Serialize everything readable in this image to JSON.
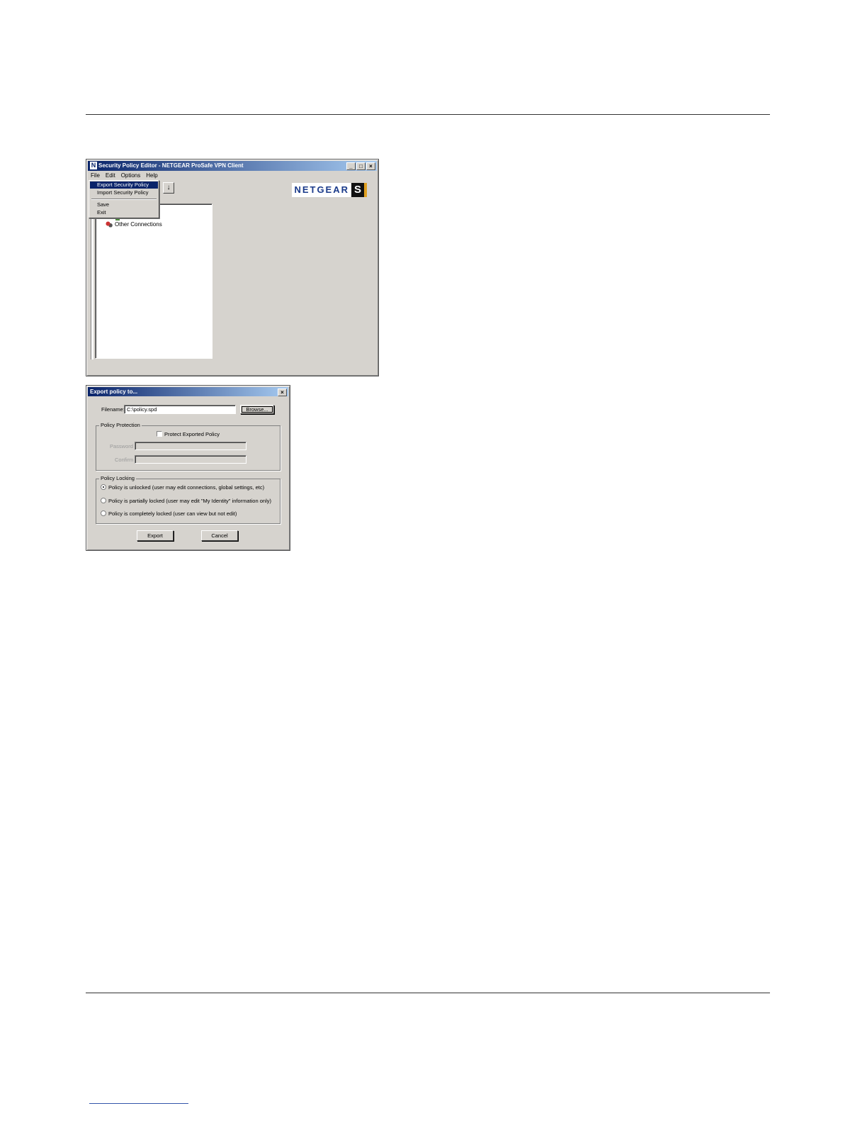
{
  "main_window": {
    "title": "Security Policy Editor - NETGEAR ProSafe VPN Client",
    "title_icon": "N",
    "controls": {
      "minimize": "_",
      "maximize": "□",
      "close": "×"
    },
    "menu": [
      "File",
      "Edit",
      "Options",
      "Help"
    ],
    "file_menu": {
      "items": [
        "Export Security Policy",
        "Import Security Policy",
        "Save",
        "Exit"
      ],
      "highlighted": "Export Security Policy"
    },
    "toolbar_arrow": "↓",
    "tree": {
      "item": "Other Connections"
    },
    "logo": {
      "text": "NETGEAR",
      "mark": "S"
    }
  },
  "export_dialog": {
    "title": "Export policy to...",
    "close": "×",
    "filename_label": "Filename:",
    "filename_value": "C:\\policy.spd",
    "browse_button": "Browse...",
    "protection": {
      "group_title": "Policy Protection",
      "checkbox_label": "Protect Exported Policy",
      "checked": false,
      "password_label": "Password",
      "confirm_label": "Confirm"
    },
    "locking": {
      "group_title": "Policy Locking",
      "options": [
        "Policy is unlocked (user may edit connections, global settings, etc)",
        "Policy is partially locked (user may edit \"My Identity\" information only)",
        "Policy is completely locked (user can view but not edit)"
      ],
      "selected": "Policy is unlocked (user may edit connections, global settings, etc)"
    },
    "export_button": "Export",
    "cancel_button": "Cancel"
  }
}
